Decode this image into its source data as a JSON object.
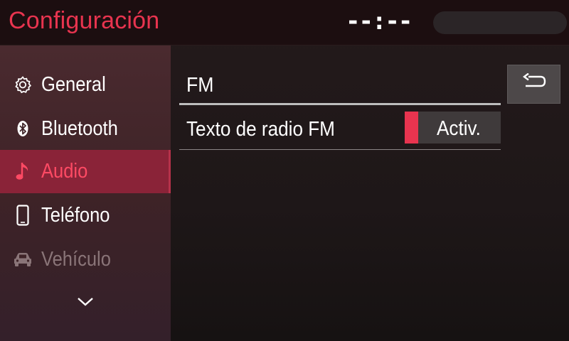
{
  "header": {
    "title": "Configuración",
    "clock": "--:--"
  },
  "sidebar": {
    "items": [
      {
        "label": "General",
        "icon": "gear-icon",
        "state": "normal"
      },
      {
        "label": "Bluetooth",
        "icon": "bluetooth-icon",
        "state": "normal"
      },
      {
        "label": "Audio",
        "icon": "music-note-icon",
        "state": "active"
      },
      {
        "label": "Teléfono",
        "icon": "phone-icon",
        "state": "normal"
      },
      {
        "label": "Vehículo",
        "icon": "car-icon",
        "state": "disabled"
      }
    ],
    "more_icon": "chevron-down-icon"
  },
  "main": {
    "section_title": "FM",
    "back_icon": "back-arrow-icon",
    "settings": [
      {
        "label": "Texto de radio FM",
        "value": "Activ.",
        "enabled": true
      }
    ]
  },
  "colors": {
    "accent": "#e8344f",
    "active_item_bg": "#8a2338",
    "header_bg": "#1c0e10",
    "toggle_bg": "#3f3a3b",
    "back_button_bg": "#4d4849"
  }
}
